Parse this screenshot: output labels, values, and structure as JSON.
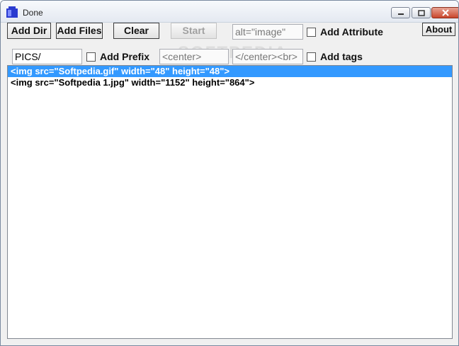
{
  "window": {
    "title": "Done"
  },
  "toolbar": {
    "add_dir": "Add Dir",
    "add_files": "Add Files",
    "clear": "Clear",
    "start": "Start",
    "alt_value": "alt=\"image\"",
    "add_attribute": "Add Attribute",
    "about": "About"
  },
  "prefix_row": {
    "prefix_value": "PICS/",
    "add_prefix": "Add Prefix",
    "open_tag_value": "<center>",
    "close_tag_value": "</center><br>",
    "add_tags": "Add tags"
  },
  "list": {
    "items": [
      "<img src=\"Softpedia.gif\" width=\"48\" height=\"48\">",
      "<img src=\"Softpedia 1.jpg\" width=\"1152\" height=\"864\">"
    ],
    "selected_index": 0
  },
  "watermark": "SOFTPEDIA"
}
